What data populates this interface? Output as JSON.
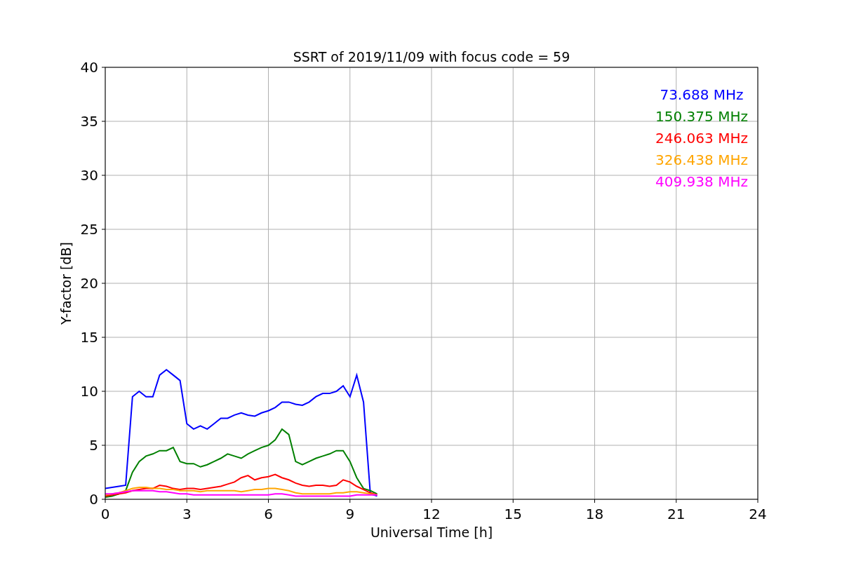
{
  "chart_data": {
    "type": "line",
    "title": "SSRT of 2019/11/09 with focus code = 59",
    "xlabel": "Universal Time [h]",
    "ylabel": "Y-factor [dB]",
    "x": [
      0,
      0.25,
      0.5,
      0.75,
      1,
      1.25,
      1.5,
      1.75,
      2,
      2.25,
      2.5,
      2.75,
      3,
      3.25,
      3.5,
      3.75,
      4,
      4.25,
      4.5,
      4.75,
      5,
      5.25,
      5.5,
      5.75,
      6,
      6.25,
      6.5,
      6.75,
      7,
      7.25,
      7.5,
      7.75,
      8,
      8.25,
      8.5,
      8.75,
      9,
      9.25,
      9.5,
      9.75,
      10
    ],
    "series": [
      {
        "name": "73.688 MHz",
        "color": "#0000ff",
        "values": [
          1.0,
          1.1,
          1.2,
          1.3,
          9.5,
          10,
          9.5,
          9.5,
          11.5,
          12,
          11.5,
          11,
          7,
          6.5,
          6.8,
          6.5,
          7,
          7.5,
          7.5,
          7.8,
          8,
          7.8,
          7.7,
          8,
          8.2,
          8.5,
          9,
          9,
          8.8,
          8.7,
          9,
          9.5,
          9.8,
          9.8,
          10,
          10.5,
          9.5,
          11.5,
          9,
          0.5,
          0.3
        ]
      },
      {
        "name": "150.375 MHz",
        "color": "#008000",
        "values": [
          0.2,
          0.3,
          0.5,
          0.8,
          2.5,
          3.5,
          4,
          4.2,
          4.5,
          4.5,
          4.8,
          3.5,
          3.3,
          3.3,
          3,
          3.2,
          3.5,
          3.8,
          4.2,
          4,
          3.8,
          4.2,
          4.5,
          4.8,
          5,
          5.5,
          6.5,
          6,
          3.5,
          3.2,
          3.5,
          3.8,
          4,
          4.2,
          4.5,
          4.5,
          3.5,
          2,
          1,
          0.8,
          0.5
        ]
      },
      {
        "name": "246.063 MHz",
        "color": "#ff0000",
        "values": [
          0.3,
          0.4,
          0.5,
          0.6,
          0.8,
          0.9,
          1,
          1,
          1.3,
          1.2,
          1,
          0.9,
          1,
          1,
          0.9,
          1,
          1.1,
          1.2,
          1.4,
          1.6,
          2,
          2.2,
          1.8,
          2,
          2.1,
          2.3,
          2,
          1.8,
          1.5,
          1.3,
          1.2,
          1.3,
          1.3,
          1.2,
          1.3,
          1.8,
          1.6,
          1.2,
          0.9,
          0.6,
          0.4
        ]
      },
      {
        "name": "326.438 MHz",
        "color": "#ffa500",
        "values": [
          0.4,
          0.5,
          0.6,
          0.8,
          1,
          1.1,
          1.1,
          1,
          1,
          0.9,
          0.9,
          0.8,
          0.8,
          0.8,
          0.7,
          0.8,
          0.8,
          0.8,
          0.8,
          0.8,
          0.7,
          0.8,
          0.9,
          0.9,
          1,
          1,
          0.9,
          0.8,
          0.6,
          0.5,
          0.5,
          0.5,
          0.5,
          0.5,
          0.6,
          0.6,
          0.7,
          0.7,
          0.6,
          0.5,
          0.4
        ]
      },
      {
        "name": "409.938 MHz",
        "color": "#ff00ff",
        "values": [
          0.5,
          0.5,
          0.6,
          0.7,
          0.8,
          0.8,
          0.8,
          0.8,
          0.7,
          0.7,
          0.6,
          0.5,
          0.5,
          0.4,
          0.4,
          0.4,
          0.4,
          0.4,
          0.4,
          0.4,
          0.4,
          0.4,
          0.4,
          0.4,
          0.4,
          0.5,
          0.5,
          0.4,
          0.3,
          0.3,
          0.3,
          0.3,
          0.3,
          0.3,
          0.3,
          0.3,
          0.3,
          0.4,
          0.4,
          0.4,
          0.4
        ]
      }
    ],
    "grid": true,
    "xlim": [
      0,
      24
    ],
    "ylim": [
      0,
      40
    ],
    "xticks": [
      0,
      3,
      6,
      9,
      12,
      15,
      18,
      21,
      24
    ],
    "yticks": [
      0,
      5,
      10,
      15,
      20,
      25,
      30,
      35,
      40
    ]
  }
}
